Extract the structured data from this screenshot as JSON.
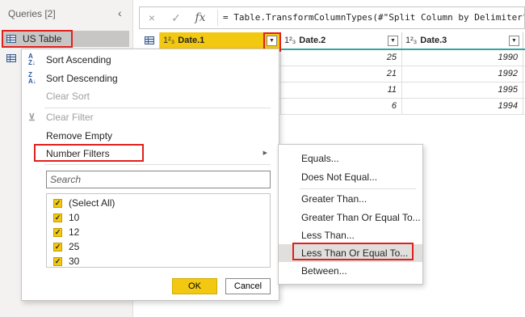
{
  "queries": {
    "header": "Queries [2]",
    "collapse_icon": "chevron-left-icon",
    "items": [
      {
        "label": "US Table",
        "selected": true
      }
    ]
  },
  "formula_bar": {
    "cancel_icon": "×",
    "confirm_icon": "✓",
    "fx_label": "fx",
    "formula": "= Table.TransformColumnTypes(#\"Split Column by Delimiter\",{"
  },
  "grid": {
    "columns": [
      {
        "type": "1²₃",
        "name": "Date.1",
        "active": true
      },
      {
        "type": "1²₃",
        "name": "Date.2",
        "active": false
      },
      {
        "type": "1²₃",
        "name": "Date.3",
        "active": false
      }
    ],
    "rows": [
      {
        "date2": "25",
        "date3": "1990"
      },
      {
        "date2": "21",
        "date3": "1992"
      },
      {
        "date2": "11",
        "date3": "1995"
      },
      {
        "date2": "6",
        "date3": "1994"
      }
    ],
    "accent_color": "#2ea9a0",
    "active_column_color": "#f2c811"
  },
  "filter_menu": {
    "sort_ascending": "Sort Ascending",
    "sort_descending": "Sort Descending",
    "clear_sort": "Clear Sort",
    "clear_filter": "Clear Filter",
    "remove_empty": "Remove Empty",
    "number_filters": "Number Filters",
    "search_placeholder": "Search",
    "checklist": [
      {
        "label": "(Select All)",
        "checked": true
      },
      {
        "label": "10",
        "checked": true
      },
      {
        "label": "12",
        "checked": true
      },
      {
        "label": "25",
        "checked": true
      },
      {
        "label": "30",
        "checked": true
      }
    ],
    "ok_label": "OK",
    "cancel_label": "Cancel"
  },
  "number_filters_submenu": {
    "items": [
      "Equals...",
      "Does Not Equal...",
      "Greater Than...",
      "Greater Than Or Equal To...",
      "Less Than...",
      "Less Than Or Equal To...",
      "Between..."
    ],
    "highlighted": "Less Than Or Equal To..."
  },
  "highlight_color": "#e0201c"
}
